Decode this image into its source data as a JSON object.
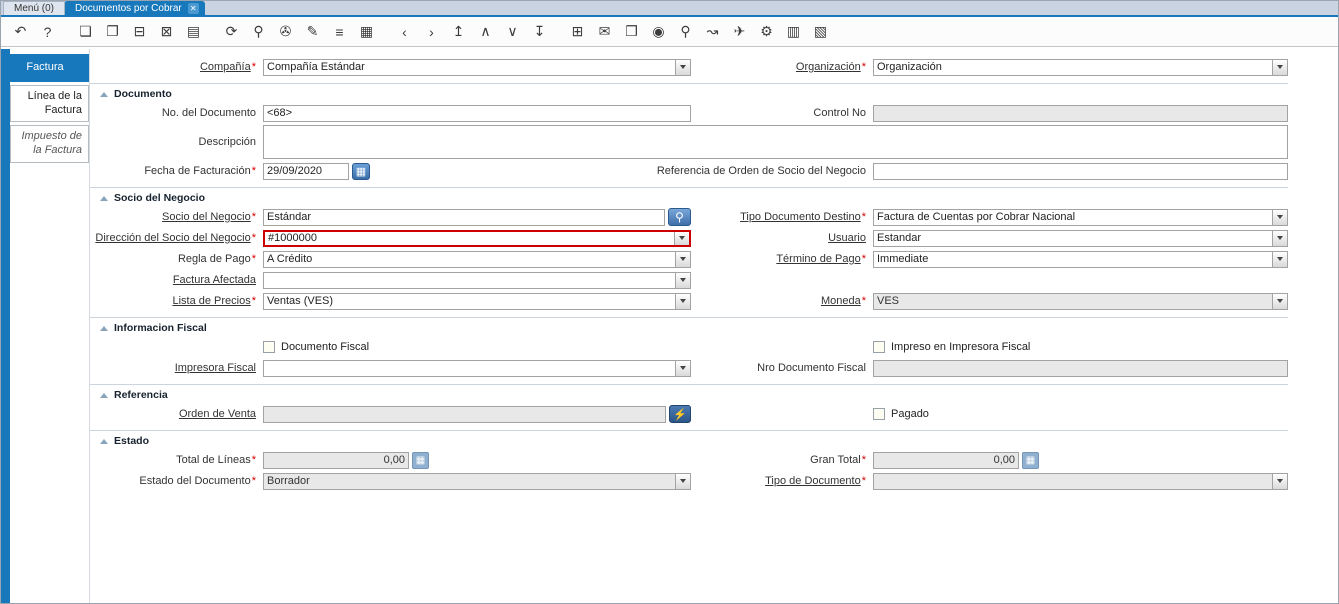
{
  "ui": {
    "accent": "#1878bc",
    "highlight": "#cc0000",
    "disabled_bg": "#e8e8e8",
    "required_marker": "*",
    "close_glyph": "✕",
    "calendar_glyph": "▦",
    "calc_glyph": "▦",
    "socio_btn_glyph": "⚲",
    "orden_btn_glyph": "⚡"
  },
  "titlebar": {
    "menu_tab": "Menú (0)",
    "doc_tab": "Documentos por Cobrar"
  },
  "toolbar": {
    "icons": [
      {
        "name": "undo-icon",
        "glyph": "↶"
      },
      {
        "name": "help-icon",
        "glyph": "?"
      },
      {
        "name": "new-record-icon",
        "glyph": "❏",
        "group": true
      },
      {
        "name": "copy-record-icon",
        "glyph": "❐"
      },
      {
        "name": "delete-record-icon",
        "glyph": "⊟"
      },
      {
        "name": "delete-selection-icon",
        "glyph": "⊠"
      },
      {
        "name": "save-icon",
        "glyph": "▤"
      },
      {
        "name": "refresh-icon",
        "glyph": "⟳",
        "group": true
      },
      {
        "name": "find-icon",
        "glyph": "⚲"
      },
      {
        "name": "attachment-icon",
        "glyph": "✇"
      },
      {
        "name": "chat-icon",
        "glyph": "✎"
      },
      {
        "name": "grid-toggle-icon",
        "glyph": "≡"
      },
      {
        "name": "calendar-icon",
        "glyph": "▦"
      },
      {
        "name": "parent-record-icon",
        "glyph": "‹",
        "group": true
      },
      {
        "name": "detail-record-icon",
        "glyph": "›"
      },
      {
        "name": "first-record-icon",
        "glyph": "↥"
      },
      {
        "name": "previous-record-icon",
        "glyph": "∧"
      },
      {
        "name": "next-record-icon",
        "glyph": "∨"
      },
      {
        "name": "last-record-icon",
        "glyph": "↧"
      },
      {
        "name": "form-icon",
        "glyph": "⊞",
        "group": true
      },
      {
        "name": "mail-icon",
        "glyph": "✉"
      },
      {
        "name": "print-icon",
        "glyph": "❒"
      },
      {
        "name": "lock-icon",
        "glyph": "◉"
      },
      {
        "name": "zoom-across-icon",
        "glyph": "⚲"
      },
      {
        "name": "workflow-icon",
        "glyph": "↝"
      },
      {
        "name": "request-icon",
        "glyph": "✈"
      },
      {
        "name": "preferences-icon",
        "glyph": "⚙"
      },
      {
        "name": "report-icon",
        "glyph": "▥"
      },
      {
        "name": "archive-icon",
        "glyph": "▧"
      }
    ]
  },
  "sidebar": {
    "factura": "Factura",
    "linea": "Línea de la Factura",
    "impuesto": "Impuesto de la Factura"
  },
  "form": {
    "compania_label": "Compañía",
    "compania_value": "Compañía Estándar",
    "organizacion_label": "Organización",
    "organizacion_value": "Organización",
    "documento": {
      "title": "Documento",
      "no_doc_label": "No. del Documento",
      "no_doc_value": "<68>",
      "control_label": "Control No",
      "control_value": "",
      "desc_label": "Descripción",
      "desc_value": "",
      "fecha_label": "Fecha de Facturación",
      "fecha_value": "29/09/2020",
      "ref_label": "Referencia de Orden de Socio del Negocio",
      "ref_value": ""
    },
    "socio": {
      "title": "Socio del Negocio",
      "socio_label": "Socio del Negocio",
      "socio_value": "Estándar",
      "tipo_destino_label": "Tipo Documento Destino",
      "tipo_destino_value": "Factura de Cuentas por Cobrar Nacional",
      "direccion_label": "Dirección del Socio del Negocio",
      "direccion_value": "#1000000",
      "usuario_label": "Usuario",
      "usuario_value": "Estandar",
      "regla_label": "Regla de Pago",
      "regla_value": "A Crédito",
      "termino_label": "Término de Pago",
      "termino_value": "Immediate",
      "afectada_label": "Factura Afectada",
      "afectada_value": "",
      "lista_label": "Lista de Precios",
      "lista_value": "Ventas (VES)",
      "moneda_label": "Moneda",
      "moneda_value": "VES"
    },
    "fiscal": {
      "title": "Informacion Fiscal",
      "doc_fiscal_label": "Documento Fiscal",
      "impreso_label": "Impreso en Impresora Fiscal",
      "impresora_label": "Impresora Fiscal",
      "impresora_value": "",
      "nro_label": "Nro Documento Fiscal",
      "nro_value": ""
    },
    "referencia": {
      "title": "Referencia",
      "orden_label": "Orden de Venta",
      "orden_value": "",
      "pagado_label": "Pagado"
    },
    "estado": {
      "title": "Estado",
      "total_label": "Total de Líneas",
      "total_value": "0,00",
      "gran_label": "Gran Total",
      "gran_value": "0,00",
      "estado_label": "Estado del Documento",
      "estado_value": "Borrador",
      "tipo_label": "Tipo de Documento",
      "tipo_value": ""
    }
  }
}
